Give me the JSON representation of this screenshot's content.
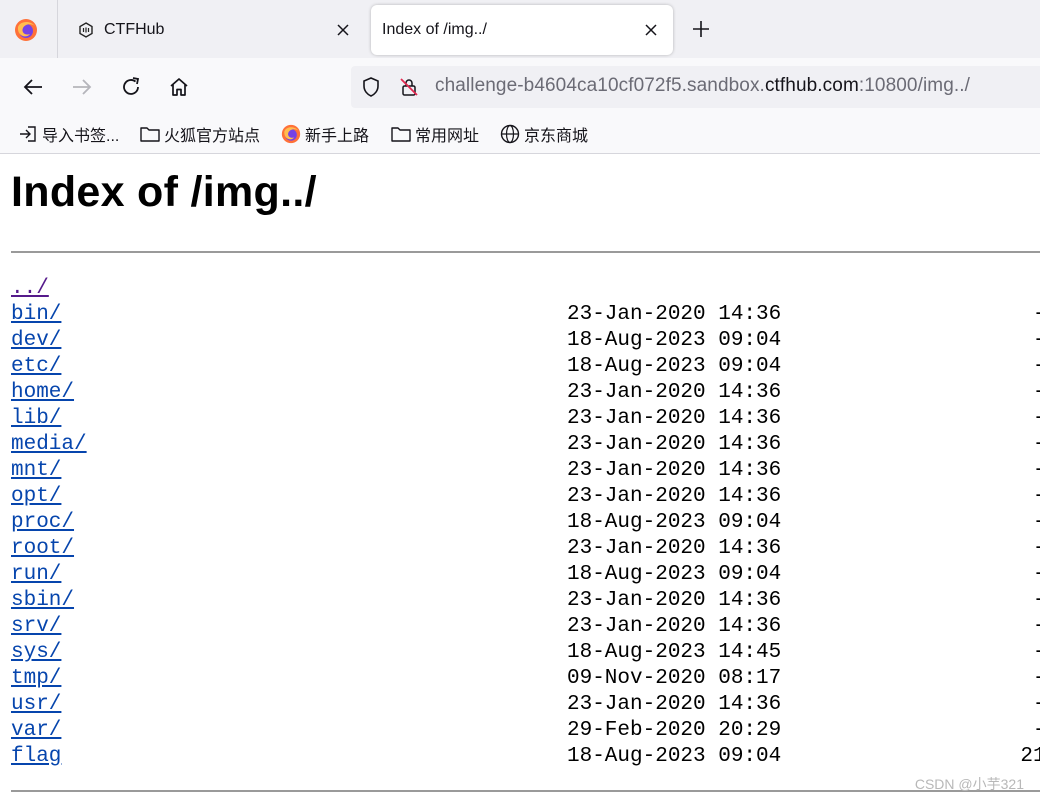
{
  "browser": {
    "tabs": [
      {
        "title": "CTFHub",
        "active": false
      },
      {
        "title": "Index of /img../",
        "active": true
      }
    ],
    "url": {
      "prefix": "challenge-b4604ca10cf072f5.sandbox.",
      "domain": "ctfhub.com",
      "suffix": ":10800/img../"
    },
    "bookmarks": [
      {
        "label": "导入书签...",
        "icon": "import-icon"
      },
      {
        "label": "火狐官方站点",
        "icon": "folder-icon"
      },
      {
        "label": "新手上路",
        "icon": "firefox-icon"
      },
      {
        "label": "常用网址",
        "icon": "folder-icon"
      },
      {
        "label": "京东商城",
        "icon": "globe-icon"
      }
    ]
  },
  "page": {
    "title": "Index of /img../",
    "parent_link": "../",
    "entries": [
      {
        "name": "bin/",
        "date": "23-Jan-2020 14:36",
        "size": "-"
      },
      {
        "name": "dev/",
        "date": "18-Aug-2023 09:04",
        "size": "-"
      },
      {
        "name": "etc/",
        "date": "18-Aug-2023 09:04",
        "size": "-"
      },
      {
        "name": "home/",
        "date": "23-Jan-2020 14:36",
        "size": "-"
      },
      {
        "name": "lib/",
        "date": "23-Jan-2020 14:36",
        "size": "-"
      },
      {
        "name": "media/",
        "date": "23-Jan-2020 14:36",
        "size": "-"
      },
      {
        "name": "mnt/",
        "date": "23-Jan-2020 14:36",
        "size": "-"
      },
      {
        "name": "opt/",
        "date": "23-Jan-2020 14:36",
        "size": "-"
      },
      {
        "name": "proc/",
        "date": "18-Aug-2023 09:04",
        "size": "-"
      },
      {
        "name": "root/",
        "date": "23-Jan-2020 14:36",
        "size": "-"
      },
      {
        "name": "run/",
        "date": "18-Aug-2023 09:04",
        "size": "-"
      },
      {
        "name": "sbin/",
        "date": "23-Jan-2020 14:36",
        "size": "-"
      },
      {
        "name": "srv/",
        "date": "23-Jan-2020 14:36",
        "size": "-"
      },
      {
        "name": "sys/",
        "date": "18-Aug-2023 14:45",
        "size": "-"
      },
      {
        "name": "tmp/",
        "date": "09-Nov-2020 08:17",
        "size": "-"
      },
      {
        "name": "usr/",
        "date": "23-Jan-2020 14:36",
        "size": "-"
      },
      {
        "name": "var/",
        "date": "29-Feb-2020 20:29",
        "size": "-"
      },
      {
        "name": "flag",
        "date": "18-Aug-2023 09:04",
        "size": "21"
      }
    ]
  },
  "watermark": "CSDN @小芋321",
  "colors": {
    "link": "#0645ad",
    "visited": "#551a8b",
    "chrome": "#f0f0f4"
  }
}
